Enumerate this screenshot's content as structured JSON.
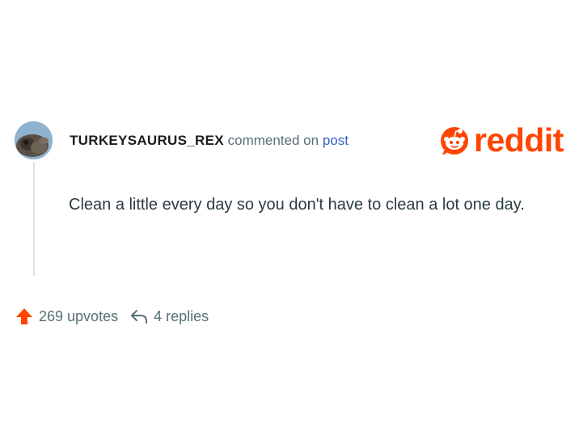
{
  "comment": {
    "username": "TURKEYSAURUS_REX",
    "action_text": "commented on",
    "target_link": "post",
    "body": "Clean a little every day so you don't have to clean a lot one day."
  },
  "brand": {
    "wordmark": "reddit",
    "color": "#ff4500",
    "icon": "reddit-snoo-icon"
  },
  "actions": {
    "upvotes": "269 upvotes",
    "replies": "4 replies",
    "upvote_icon": "upvote-arrow-icon",
    "reply_icon": "reply-arrow-icon"
  },
  "colors": {
    "accent": "#ff4500",
    "link": "#2e5ec7",
    "muted": "#576f76",
    "body_text": "#2a3c42"
  }
}
